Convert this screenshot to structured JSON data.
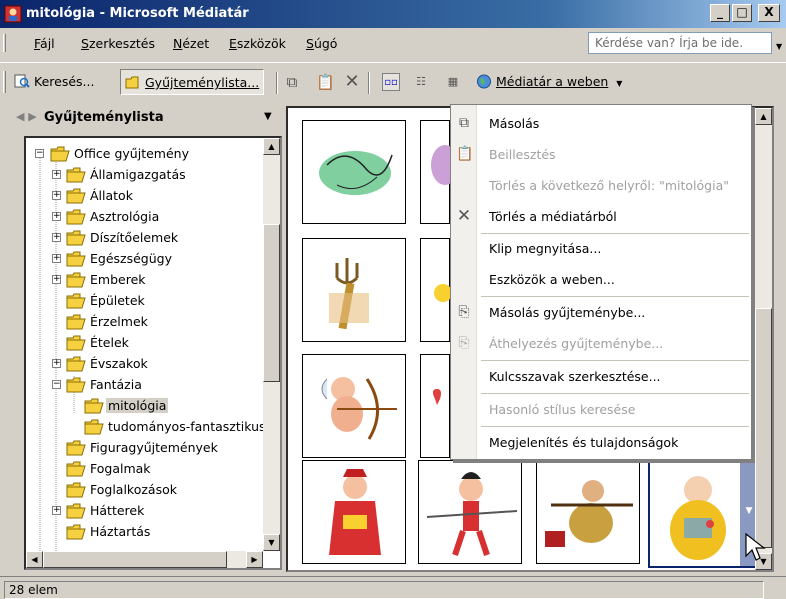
{
  "window": {
    "title": "mitológia - Microsoft Médiatár",
    "minimize_label": "_",
    "maximize_label": "□",
    "close_label": "X"
  },
  "menubar": {
    "items": [
      "Fájl",
      "Szerkesztés",
      "Nézet",
      "Eszközök",
      "Súgó"
    ],
    "help_placeholder": "Kérdése van? Írja be ide."
  },
  "toolbar": {
    "search_label": "Keresés...",
    "collections_label": "Gyűjteménylista...",
    "web_label": "Médiatár a weben"
  },
  "left_pane": {
    "header": "Gyűjteménylista",
    "tree": [
      "Office gyűjtemény",
      "Államigazgatás",
      "Állatok",
      "Asztrológia",
      "Díszítőelemek",
      "Egészségügy",
      "Emberek",
      "Épületek",
      "Érzelmek",
      "Ételek",
      "Évszakok",
      "Fantázia",
      "mitológia",
      "tudományos-fantasztikus",
      "Figuragyűjtemények",
      "Fogalmak",
      "Foglalkozások",
      "Hátterek",
      "Háztartás"
    ]
  },
  "context_menu": {
    "items": [
      "Másolás",
      "Beillesztés",
      "Törlés a következő helyről: \"mitológia\"",
      "Törlés a médiatárból",
      "Klip megnyitása...",
      "Eszközök a weben...",
      "Másolás gyűjteménybe...",
      "Áthelyezés gyűjteménybe...",
      "Kulcsszavak szerkesztése...",
      "Hasonló stílus keresése",
      "Megjelenítés és tulajdonságok"
    ]
  },
  "status": {
    "text": "28 elem"
  }
}
